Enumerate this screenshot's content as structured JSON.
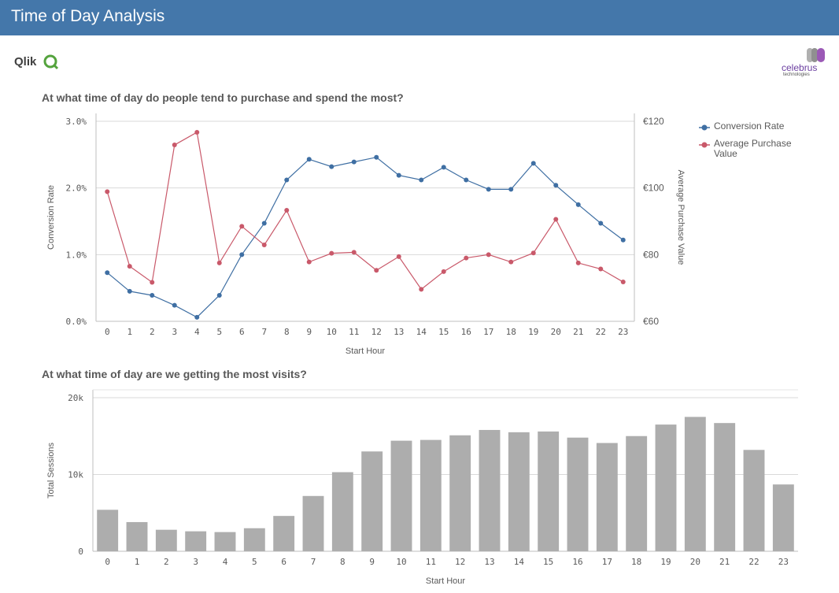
{
  "header": {
    "title": "Time of Day Analysis"
  },
  "logos": {
    "qlik": "Qlik",
    "celebrus": "celebrus",
    "celebrus_sub": "technologies"
  },
  "colors": {
    "header": "#4477aa",
    "conversion": "#3f6fa3",
    "purchase": "#c9596a",
    "bars": "#adadad"
  },
  "chart1_title": "At what time of day do people tend to purchase and spend the most?",
  "chart2_title": "At what time of day are we getting the most visits?",
  "legend": {
    "conversion": "Conversion Rate",
    "purchase": "Average Purchase Value"
  },
  "chart_data": [
    {
      "type": "line",
      "title": "At what time of day do people tend to purchase and spend the most?",
      "xlabel": "Start Hour",
      "ylabel": "Conversion Rate",
      "y2label": "Average Purchase Value",
      "x": [
        "0",
        "1",
        "2",
        "3",
        "4",
        "5",
        "6",
        "7",
        "8",
        "9",
        "10",
        "11",
        "12",
        "13",
        "14",
        "15",
        "16",
        "17",
        "18",
        "19",
        "20",
        "21",
        "22",
        "23"
      ],
      "ylim": [
        0,
        3.0
      ],
      "yticks": [
        "0.0%",
        "1.0%",
        "2.0%",
        "3.0%"
      ],
      "y2lim": [
        60,
        120
      ],
      "y2ticks": [
        "€60",
        "€80",
        "€100",
        "€120"
      ],
      "legend_position": "top-right",
      "series": [
        {
          "name": "Conversion Rate",
          "axis": "left",
          "values": [
            0.73,
            0.45,
            0.39,
            0.24,
            0.06,
            0.39,
            1.0,
            1.47,
            2.12,
            2.43,
            2.32,
            2.39,
            2.46,
            2.19,
            2.12,
            2.31,
            2.12,
            1.98,
            1.98,
            2.37,
            2.04,
            1.75,
            1.47,
            1.22
          ]
        },
        {
          "name": "Average Purchase Value",
          "axis": "right",
          "values": [
            98.9,
            76.5,
            71.7,
            112.9,
            116.7,
            77.5,
            88.5,
            82.9,
            93.3,
            77.8,
            80.4,
            80.7,
            75.3,
            79.4,
            69.6,
            74.9,
            79.0,
            80.0,
            77.8,
            80.5,
            90.6,
            77.5,
            75.7,
            71.8
          ]
        }
      ]
    },
    {
      "type": "bar",
      "title": "At what time of day are we getting the most visits?",
      "xlabel": "Start Hour",
      "ylabel": "Total Sessions",
      "categories": [
        "0",
        "1",
        "2",
        "3",
        "4",
        "5",
        "6",
        "7",
        "8",
        "9",
        "10",
        "11",
        "12",
        "13",
        "14",
        "15",
        "16",
        "17",
        "18",
        "19",
        "20",
        "21",
        "22",
        "23"
      ],
      "ylim": [
        0,
        20000
      ],
      "yticks": [
        "0",
        "10k",
        "20k"
      ],
      "series": [
        {
          "name": "Total Sessions",
          "values": [
            5400,
            3800,
            2800,
            2600,
            2500,
            3000,
            4600,
            7200,
            10300,
            13000,
            14400,
            14500,
            15100,
            15800,
            15500,
            15600,
            14800,
            14100,
            15000,
            16500,
            17500,
            16700,
            13200,
            8700
          ]
        }
      ]
    }
  ]
}
